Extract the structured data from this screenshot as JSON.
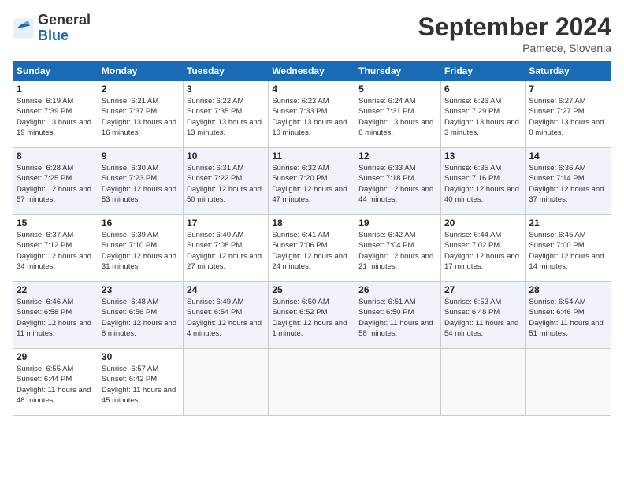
{
  "header": {
    "logo_general": "General",
    "logo_blue": "Blue",
    "month_title": "September 2024",
    "location": "Pamece, Slovenia"
  },
  "weekdays": [
    "Sunday",
    "Monday",
    "Tuesday",
    "Wednesday",
    "Thursday",
    "Friday",
    "Saturday"
  ],
  "weeks": [
    [
      {
        "day": "1",
        "sunrise": "6:19 AM",
        "sunset": "7:39 PM",
        "daylight": "13 hours and 19 minutes."
      },
      {
        "day": "2",
        "sunrise": "6:21 AM",
        "sunset": "7:37 PM",
        "daylight": "13 hours and 16 minutes."
      },
      {
        "day": "3",
        "sunrise": "6:22 AM",
        "sunset": "7:35 PM",
        "daylight": "13 hours and 13 minutes."
      },
      {
        "day": "4",
        "sunrise": "6:23 AM",
        "sunset": "7:33 PM",
        "daylight": "13 hours and 10 minutes."
      },
      {
        "day": "5",
        "sunrise": "6:24 AM",
        "sunset": "7:31 PM",
        "daylight": "13 hours and 6 minutes."
      },
      {
        "day": "6",
        "sunrise": "6:26 AM",
        "sunset": "7:29 PM",
        "daylight": "13 hours and 3 minutes."
      },
      {
        "day": "7",
        "sunrise": "6:27 AM",
        "sunset": "7:27 PM",
        "daylight": "13 hours and 0 minutes."
      }
    ],
    [
      {
        "day": "8",
        "sunrise": "6:28 AM",
        "sunset": "7:25 PM",
        "daylight": "12 hours and 57 minutes."
      },
      {
        "day": "9",
        "sunrise": "6:30 AM",
        "sunset": "7:23 PM",
        "daylight": "12 hours and 53 minutes."
      },
      {
        "day": "10",
        "sunrise": "6:31 AM",
        "sunset": "7:22 PM",
        "daylight": "12 hours and 50 minutes."
      },
      {
        "day": "11",
        "sunrise": "6:32 AM",
        "sunset": "7:20 PM",
        "daylight": "12 hours and 47 minutes."
      },
      {
        "day": "12",
        "sunrise": "6:33 AM",
        "sunset": "7:18 PM",
        "daylight": "12 hours and 44 minutes."
      },
      {
        "day": "13",
        "sunrise": "6:35 AM",
        "sunset": "7:16 PM",
        "daylight": "12 hours and 40 minutes."
      },
      {
        "day": "14",
        "sunrise": "6:36 AM",
        "sunset": "7:14 PM",
        "daylight": "12 hours and 37 minutes."
      }
    ],
    [
      {
        "day": "15",
        "sunrise": "6:37 AM",
        "sunset": "7:12 PM",
        "daylight": "12 hours and 34 minutes."
      },
      {
        "day": "16",
        "sunrise": "6:39 AM",
        "sunset": "7:10 PM",
        "daylight": "12 hours and 31 minutes."
      },
      {
        "day": "17",
        "sunrise": "6:40 AM",
        "sunset": "7:08 PM",
        "daylight": "12 hours and 27 minutes."
      },
      {
        "day": "18",
        "sunrise": "6:41 AM",
        "sunset": "7:06 PM",
        "daylight": "12 hours and 24 minutes."
      },
      {
        "day": "19",
        "sunrise": "6:42 AM",
        "sunset": "7:04 PM",
        "daylight": "12 hours and 21 minutes."
      },
      {
        "day": "20",
        "sunrise": "6:44 AM",
        "sunset": "7:02 PM",
        "daylight": "12 hours and 17 minutes."
      },
      {
        "day": "21",
        "sunrise": "6:45 AM",
        "sunset": "7:00 PM",
        "daylight": "12 hours and 14 minutes."
      }
    ],
    [
      {
        "day": "22",
        "sunrise": "6:46 AM",
        "sunset": "6:58 PM",
        "daylight": "12 hours and 11 minutes."
      },
      {
        "day": "23",
        "sunrise": "6:48 AM",
        "sunset": "6:56 PM",
        "daylight": "12 hours and 8 minutes."
      },
      {
        "day": "24",
        "sunrise": "6:49 AM",
        "sunset": "6:54 PM",
        "daylight": "12 hours and 4 minutes."
      },
      {
        "day": "25",
        "sunrise": "6:50 AM",
        "sunset": "6:52 PM",
        "daylight": "12 hours and 1 minute."
      },
      {
        "day": "26",
        "sunrise": "6:51 AM",
        "sunset": "6:50 PM",
        "daylight": "11 hours and 58 minutes."
      },
      {
        "day": "27",
        "sunrise": "6:53 AM",
        "sunset": "6:48 PM",
        "daylight": "11 hours and 54 minutes."
      },
      {
        "day": "28",
        "sunrise": "6:54 AM",
        "sunset": "6:46 PM",
        "daylight": "11 hours and 51 minutes."
      }
    ],
    [
      {
        "day": "29",
        "sunrise": "6:55 AM",
        "sunset": "6:44 PM",
        "daylight": "11 hours and 48 minutes."
      },
      {
        "day": "30",
        "sunrise": "6:57 AM",
        "sunset": "6:42 PM",
        "daylight": "11 hours and 45 minutes."
      },
      null,
      null,
      null,
      null,
      null
    ]
  ],
  "labels": {
    "sunrise": "Sunrise:",
    "sunset": "Sunset:",
    "daylight": "Daylight:"
  }
}
